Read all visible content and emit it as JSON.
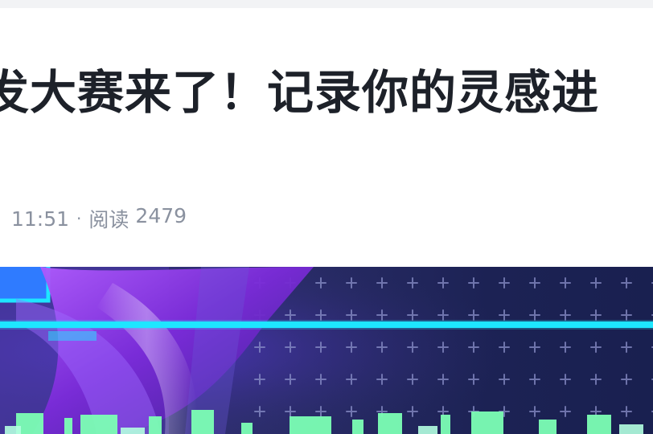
{
  "article": {
    "title": "发大赛来了！记录你的灵感进",
    "time": "11:51",
    "separator": "·",
    "views_label": "阅读",
    "views_count": "2479"
  },
  "banner": {
    "description": "event banner image",
    "colors": {
      "background": "#2b2d6a",
      "accent_cyan": "#1ee6ff",
      "accent_purple": "#8a2be2",
      "text_green": "#7cffb5"
    }
  }
}
